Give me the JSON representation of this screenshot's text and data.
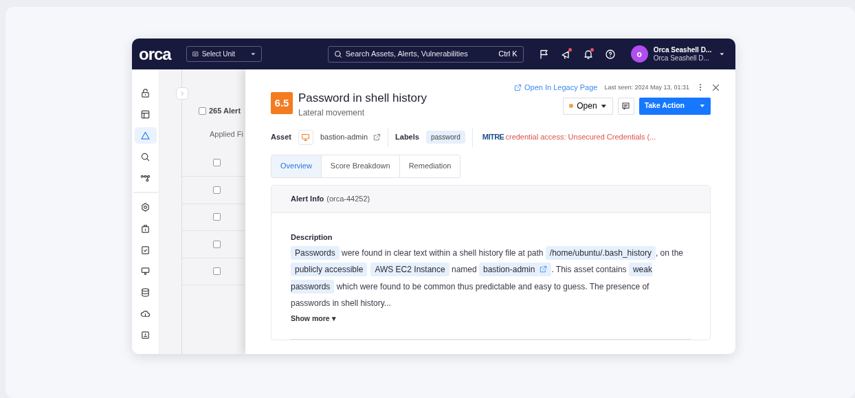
{
  "topbar": {
    "logo": "orca",
    "unit_select": {
      "label": "Select Unit"
    },
    "search": {
      "placeholder": "Search Assets, Alerts, Vulnerabilities",
      "shortcut": "Ctrl K"
    },
    "notifications": [
      {
        "unread": false
      },
      {
        "unread": true
      },
      {
        "unread": true
      },
      {
        "unread": false
      }
    ],
    "user": {
      "avatar": "o",
      "name": "Orca Seashell D...",
      "org": "Orca Seashell D..."
    }
  },
  "sidebar": {
    "items": [
      {
        "selected": false
      },
      {
        "selected": false
      },
      {
        "selected": true
      },
      {
        "selected": false
      },
      {
        "selected": false
      },
      {
        "selected": false
      },
      {
        "selected": false
      },
      {
        "selected": false
      },
      {
        "selected": false
      },
      {
        "selected": false
      },
      {
        "selected": false
      },
      {
        "selected": false
      }
    ]
  },
  "alert_list": {
    "select_all": {
      "checked": false
    },
    "count": "265 Alert",
    "applied_filters": "Applied Fi",
    "rows": [
      {
        "checked": false
      },
      {
        "checked": false
      },
      {
        "checked": false
      },
      {
        "checked": false
      },
      {
        "checked": false
      }
    ]
  },
  "drawer": {
    "legacy_link": "Open In Legacy Page",
    "last_seen": "Last seen: 2024 May 13, 01:31",
    "score": "6.5",
    "title": "Password in shell history",
    "category": "Lateral movement",
    "status": {
      "label": "Open",
      "color": "#f5a04a"
    },
    "take_action": "Take Action",
    "asset": {
      "label": "Asset",
      "name": "bastion-admin"
    },
    "labels": {
      "label": "Labels",
      "tags": [
        "password"
      ]
    },
    "mitre": {
      "logo": "MITRE",
      "text": "credential access: Unsecured Credentials (..."
    },
    "tabs": [
      {
        "label": "Overview",
        "selected": true
      },
      {
        "label": "Score Breakdown",
        "selected": false
      },
      {
        "label": "Remediation",
        "selected": false
      }
    ],
    "alert_info": {
      "title": "Alert Info",
      "id": "(orca-44252)",
      "description_label": "Description",
      "description": [
        {
          "text": "Passwords",
          "chip": true
        },
        {
          "text": " were found in clear text within a shell history file at path ",
          "chip": false
        },
        {
          "text": "/home/ubuntu/.bash_history",
          "chip": true
        },
        {
          "text": ", on the ",
          "chip": false
        },
        {
          "text": "publicly accessible",
          "chip": true
        },
        {
          "text": "AWS EC2 Instance",
          "chip": true
        },
        {
          "text": " named ",
          "chip": false
        },
        {
          "text": "bastion-admin",
          "chip": true,
          "link": true
        },
        {
          "text": ". This asset contains ",
          "chip": false
        },
        {
          "text": "weak passwords",
          "chip": true
        },
        {
          "text": " which were found to be common thus predictable and easy to guess. The presence of passwords in shell history...",
          "chip": false
        }
      ],
      "show_more": "Show more ▾"
    }
  }
}
